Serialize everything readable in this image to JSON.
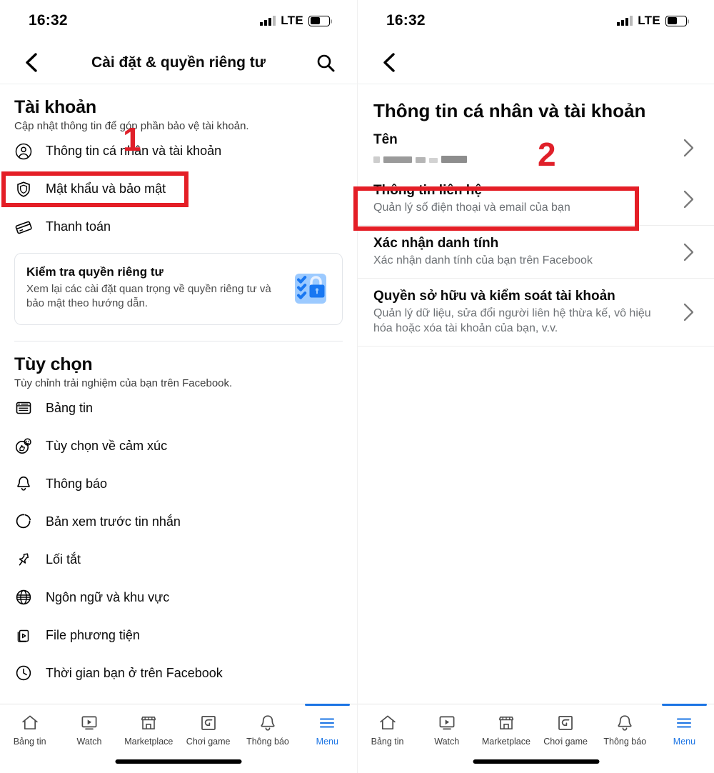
{
  "status_bar": {
    "time": "16:32",
    "network": "LTE",
    "signal_bars_filled": 3,
    "signal_bars_total": 4,
    "battery_percent": 48
  },
  "colors": {
    "accent_blue": "#1b74e4",
    "annotation_red": "#e41e26",
    "card_icon_blue": "#1877f2",
    "card_icon_light": "#9ccaff"
  },
  "left_screen": {
    "nav": {
      "title": "Cài đặt & quyền riêng tư",
      "back_icon": "chevron-left-icon",
      "search_icon": "search-icon"
    },
    "account_section": {
      "title": "Tài khoản",
      "subtitle": "Cập nhật thông tin để góp phần bảo vệ tài khoản.",
      "items": [
        {
          "label": "Thông tin cá nhân và tài khoản",
          "icon": "person-circle-icon"
        },
        {
          "label": "Mật khẩu và bảo mật",
          "icon": "shield-icon",
          "highlighted": true
        },
        {
          "label": "Thanh toán",
          "icon": "credit-card-icon"
        }
      ]
    },
    "privacy_card": {
      "title": "Kiểm tra quyền riêng tư",
      "description": "Xem lại các cài đặt quan trọng về quyền riêng tư và bảo mật theo hướng dẫn.",
      "icon": "privacy-checkup-lock-icon"
    },
    "preferences_section": {
      "title": "Tùy chọn",
      "subtitle": "Tùy chỉnh trải nghiệm của bạn trên Facebook.",
      "items": [
        {
          "label": "Bảng tin",
          "icon": "news-feed-icon"
        },
        {
          "label": "Tùy chọn về cảm xúc",
          "icon": "reactions-icon"
        },
        {
          "label": "Thông báo",
          "icon": "bell-icon"
        },
        {
          "label": "Bản xem trước tin nhắn",
          "icon": "message-preview-icon"
        },
        {
          "label": "Lối tắt",
          "icon": "pin-icon"
        },
        {
          "label": "Ngôn ngữ và khu vực",
          "icon": "globe-icon"
        },
        {
          "label": "File phương tiện",
          "icon": "media-file-icon"
        },
        {
          "label": "Thời gian bạn ở trên Facebook",
          "icon": "clock-icon"
        }
      ]
    }
  },
  "right_screen": {
    "nav": {
      "back_icon": "chevron-left-icon"
    },
    "page_title": "Thông tin cá nhân và tài khoản",
    "rows": [
      {
        "title": "Tên",
        "subtitle": "",
        "redacted_value": true,
        "arrow": "chevron-right-icon"
      },
      {
        "title": "Thông tin liên hệ",
        "subtitle": "Quản lý số điện thoại và email của bạn",
        "highlighted": true,
        "arrow": "chevron-right-icon"
      },
      {
        "title": "Xác nhận danh tính",
        "subtitle": "Xác nhận danh tính của bạn trên Facebook",
        "arrow": "chevron-right-icon"
      },
      {
        "title": "Quyền sở hữu và kiểm soát tài khoản",
        "subtitle": "Quản lý dữ liệu, sửa đổi người liên hệ thừa kế, vô hiệu hóa hoặc xóa tài khoản của bạn, v.v.",
        "arrow": "chevron-right-icon"
      }
    ]
  },
  "tabbar": {
    "tabs": [
      {
        "label": "Bảng tin",
        "icon": "home-icon",
        "active": false
      },
      {
        "label": "Watch",
        "icon": "video-play-icon",
        "active": false
      },
      {
        "label": "Marketplace",
        "icon": "store-icon",
        "active": false
      },
      {
        "label": "Chơi game",
        "icon": "gaming-icon",
        "active": false
      },
      {
        "label": "Thông báo",
        "icon": "bell-icon",
        "active": false
      },
      {
        "label": "Menu",
        "icon": "hamburger-menu-icon",
        "active": true
      }
    ]
  },
  "annotations": [
    {
      "number": "1",
      "target": "Mật khẩu và bảo mật",
      "screen": "left"
    },
    {
      "number": "2",
      "target": "Thông tin liên hệ",
      "screen": "right"
    }
  ]
}
